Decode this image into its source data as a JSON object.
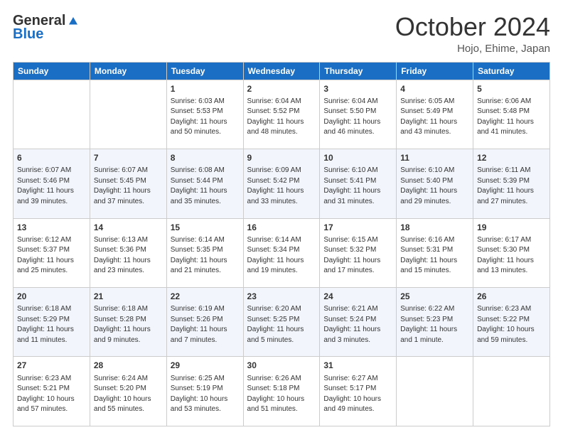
{
  "logo": {
    "general": "General",
    "blue": "Blue"
  },
  "header": {
    "month": "October 2024",
    "location": "Hojo, Ehime, Japan"
  },
  "days_of_week": [
    "Sunday",
    "Monday",
    "Tuesday",
    "Wednesday",
    "Thursday",
    "Friday",
    "Saturday"
  ],
  "weeks": [
    [
      {
        "day": "",
        "sunrise": "",
        "sunset": "",
        "daylight": ""
      },
      {
        "day": "",
        "sunrise": "",
        "sunset": "",
        "daylight": ""
      },
      {
        "day": "1",
        "sunrise": "Sunrise: 6:03 AM",
        "sunset": "Sunset: 5:53 PM",
        "daylight": "Daylight: 11 hours and 50 minutes."
      },
      {
        "day": "2",
        "sunrise": "Sunrise: 6:04 AM",
        "sunset": "Sunset: 5:52 PM",
        "daylight": "Daylight: 11 hours and 48 minutes."
      },
      {
        "day": "3",
        "sunrise": "Sunrise: 6:04 AM",
        "sunset": "Sunset: 5:50 PM",
        "daylight": "Daylight: 11 hours and 46 minutes."
      },
      {
        "day": "4",
        "sunrise": "Sunrise: 6:05 AM",
        "sunset": "Sunset: 5:49 PM",
        "daylight": "Daylight: 11 hours and 43 minutes."
      },
      {
        "day": "5",
        "sunrise": "Sunrise: 6:06 AM",
        "sunset": "Sunset: 5:48 PM",
        "daylight": "Daylight: 11 hours and 41 minutes."
      }
    ],
    [
      {
        "day": "6",
        "sunrise": "Sunrise: 6:07 AM",
        "sunset": "Sunset: 5:46 PM",
        "daylight": "Daylight: 11 hours and 39 minutes."
      },
      {
        "day": "7",
        "sunrise": "Sunrise: 6:07 AM",
        "sunset": "Sunset: 5:45 PM",
        "daylight": "Daylight: 11 hours and 37 minutes."
      },
      {
        "day": "8",
        "sunrise": "Sunrise: 6:08 AM",
        "sunset": "Sunset: 5:44 PM",
        "daylight": "Daylight: 11 hours and 35 minutes."
      },
      {
        "day": "9",
        "sunrise": "Sunrise: 6:09 AM",
        "sunset": "Sunset: 5:42 PM",
        "daylight": "Daylight: 11 hours and 33 minutes."
      },
      {
        "day": "10",
        "sunrise": "Sunrise: 6:10 AM",
        "sunset": "Sunset: 5:41 PM",
        "daylight": "Daylight: 11 hours and 31 minutes."
      },
      {
        "day": "11",
        "sunrise": "Sunrise: 6:10 AM",
        "sunset": "Sunset: 5:40 PM",
        "daylight": "Daylight: 11 hours and 29 minutes."
      },
      {
        "day": "12",
        "sunrise": "Sunrise: 6:11 AM",
        "sunset": "Sunset: 5:39 PM",
        "daylight": "Daylight: 11 hours and 27 minutes."
      }
    ],
    [
      {
        "day": "13",
        "sunrise": "Sunrise: 6:12 AM",
        "sunset": "Sunset: 5:37 PM",
        "daylight": "Daylight: 11 hours and 25 minutes."
      },
      {
        "day": "14",
        "sunrise": "Sunrise: 6:13 AM",
        "sunset": "Sunset: 5:36 PM",
        "daylight": "Daylight: 11 hours and 23 minutes."
      },
      {
        "day": "15",
        "sunrise": "Sunrise: 6:14 AM",
        "sunset": "Sunset: 5:35 PM",
        "daylight": "Daylight: 11 hours and 21 minutes."
      },
      {
        "day": "16",
        "sunrise": "Sunrise: 6:14 AM",
        "sunset": "Sunset: 5:34 PM",
        "daylight": "Daylight: 11 hours and 19 minutes."
      },
      {
        "day": "17",
        "sunrise": "Sunrise: 6:15 AM",
        "sunset": "Sunset: 5:32 PM",
        "daylight": "Daylight: 11 hours and 17 minutes."
      },
      {
        "day": "18",
        "sunrise": "Sunrise: 6:16 AM",
        "sunset": "Sunset: 5:31 PM",
        "daylight": "Daylight: 11 hours and 15 minutes."
      },
      {
        "day": "19",
        "sunrise": "Sunrise: 6:17 AM",
        "sunset": "Sunset: 5:30 PM",
        "daylight": "Daylight: 11 hours and 13 minutes."
      }
    ],
    [
      {
        "day": "20",
        "sunrise": "Sunrise: 6:18 AM",
        "sunset": "Sunset: 5:29 PM",
        "daylight": "Daylight: 11 hours and 11 minutes."
      },
      {
        "day": "21",
        "sunrise": "Sunrise: 6:18 AM",
        "sunset": "Sunset: 5:28 PM",
        "daylight": "Daylight: 11 hours and 9 minutes."
      },
      {
        "day": "22",
        "sunrise": "Sunrise: 6:19 AM",
        "sunset": "Sunset: 5:26 PM",
        "daylight": "Daylight: 11 hours and 7 minutes."
      },
      {
        "day": "23",
        "sunrise": "Sunrise: 6:20 AM",
        "sunset": "Sunset: 5:25 PM",
        "daylight": "Daylight: 11 hours and 5 minutes."
      },
      {
        "day": "24",
        "sunrise": "Sunrise: 6:21 AM",
        "sunset": "Sunset: 5:24 PM",
        "daylight": "Daylight: 11 hours and 3 minutes."
      },
      {
        "day": "25",
        "sunrise": "Sunrise: 6:22 AM",
        "sunset": "Sunset: 5:23 PM",
        "daylight": "Daylight: 11 hours and 1 minute."
      },
      {
        "day": "26",
        "sunrise": "Sunrise: 6:23 AM",
        "sunset": "Sunset: 5:22 PM",
        "daylight": "Daylight: 10 hours and 59 minutes."
      }
    ],
    [
      {
        "day": "27",
        "sunrise": "Sunrise: 6:23 AM",
        "sunset": "Sunset: 5:21 PM",
        "daylight": "Daylight: 10 hours and 57 minutes."
      },
      {
        "day": "28",
        "sunrise": "Sunrise: 6:24 AM",
        "sunset": "Sunset: 5:20 PM",
        "daylight": "Daylight: 10 hours and 55 minutes."
      },
      {
        "day": "29",
        "sunrise": "Sunrise: 6:25 AM",
        "sunset": "Sunset: 5:19 PM",
        "daylight": "Daylight: 10 hours and 53 minutes."
      },
      {
        "day": "30",
        "sunrise": "Sunrise: 6:26 AM",
        "sunset": "Sunset: 5:18 PM",
        "daylight": "Daylight: 10 hours and 51 minutes."
      },
      {
        "day": "31",
        "sunrise": "Sunrise: 6:27 AM",
        "sunset": "Sunset: 5:17 PM",
        "daylight": "Daylight: 10 hours and 49 minutes."
      },
      {
        "day": "",
        "sunrise": "",
        "sunset": "",
        "daylight": ""
      },
      {
        "day": "",
        "sunrise": "",
        "sunset": "",
        "daylight": ""
      }
    ]
  ]
}
